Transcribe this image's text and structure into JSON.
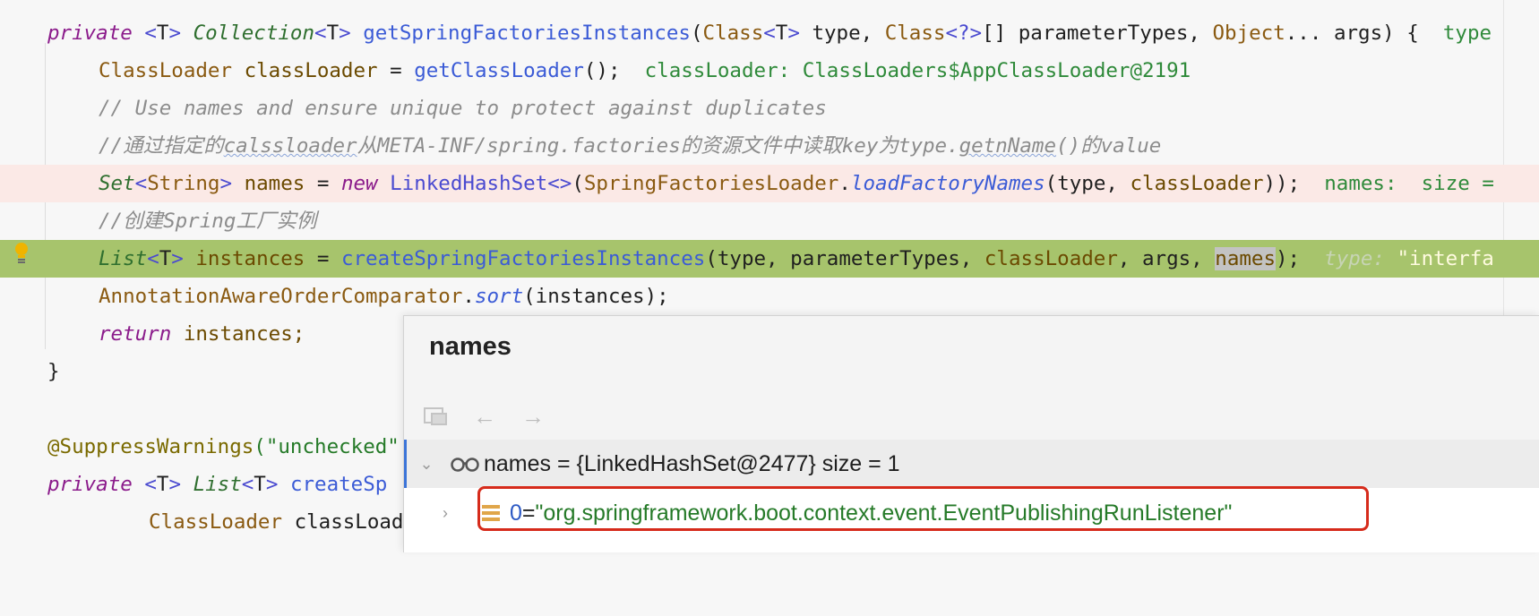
{
  "code": {
    "l1": {
      "private": "private",
      "lt": "<",
      "T": "T",
      "gt": ">",
      "sp": " ",
      "Collection": "Collection",
      "method": "getSpringFactoriesInstances",
      "Class": "Class",
      "wild": "<?>",
      "arr": "[]",
      "type": "type",
      "parameterTypes": "parameterTypes",
      "Object": "Object",
      "dots": "...",
      "args": "args",
      "brace": ") {",
      "hint": "type"
    },
    "l2": {
      "ClassLoader": "ClassLoader",
      "var": "classLoader",
      "eq": " = ",
      "call": "getClassLoader",
      "end": "();",
      "hint": "classLoader: ClassLoaders$AppClassLoader@2191"
    },
    "l3": {
      "comment": "// Use names and ensure unique to protect against duplicates"
    },
    "l4": {
      "a": "//通过指定的",
      "b": "calssloader",
      "c": "从META-INF/spring.factories的资源文件中读取key为type.",
      "d": "getnName",
      "e": "()的value"
    },
    "l5": {
      "Set": "Set",
      "String": "String",
      "names": "names",
      "new": "new",
      "LinkedHashSet": "LinkedHashSet<>",
      "SFL": "SpringFactoriesLoader",
      "load": "loadFactoryNames",
      "typeArg": "type",
      "cl": "classLoader",
      "end": "));",
      "hint": "names:  size ="
    },
    "l6": {
      "comment": "//创建Spring工厂实例"
    },
    "l7": {
      "List": "List",
      "instances": "instances",
      "create": "createSpringFactoriesInstances",
      "names": "names",
      "end": ");",
      "hint_key": "type:",
      "hint_val": "\"interfa"
    },
    "l8": {
      "AAOC": "AnnotationAwareOrderComparator",
      "sort": "sort",
      "arg": "(instances);"
    },
    "l9": {
      "ret": "return",
      "rest": "instances;"
    },
    "l10": {
      "close": "}"
    },
    "l12": {
      "ann": "@SuppressWarnings",
      "str": "(\"unchecked\""
    },
    "l13": {
      "private": "private",
      "List": "List",
      "create": "createSp"
    },
    "l14": {
      "ClassLoader": "ClassLoader",
      "partial": "classLoad"
    }
  },
  "popup": {
    "title": "names",
    "tools": {
      "copy_icon": "folder-copy-icon",
      "back": "←",
      "forward": "→"
    },
    "root": {
      "label": "names = {LinkedHashSet@2477}  size = 1"
    },
    "child": {
      "index": "0",
      "eq": " = ",
      "value": "\"org.springframework.boot.context.event.EventPublishingRunListener\""
    }
  }
}
